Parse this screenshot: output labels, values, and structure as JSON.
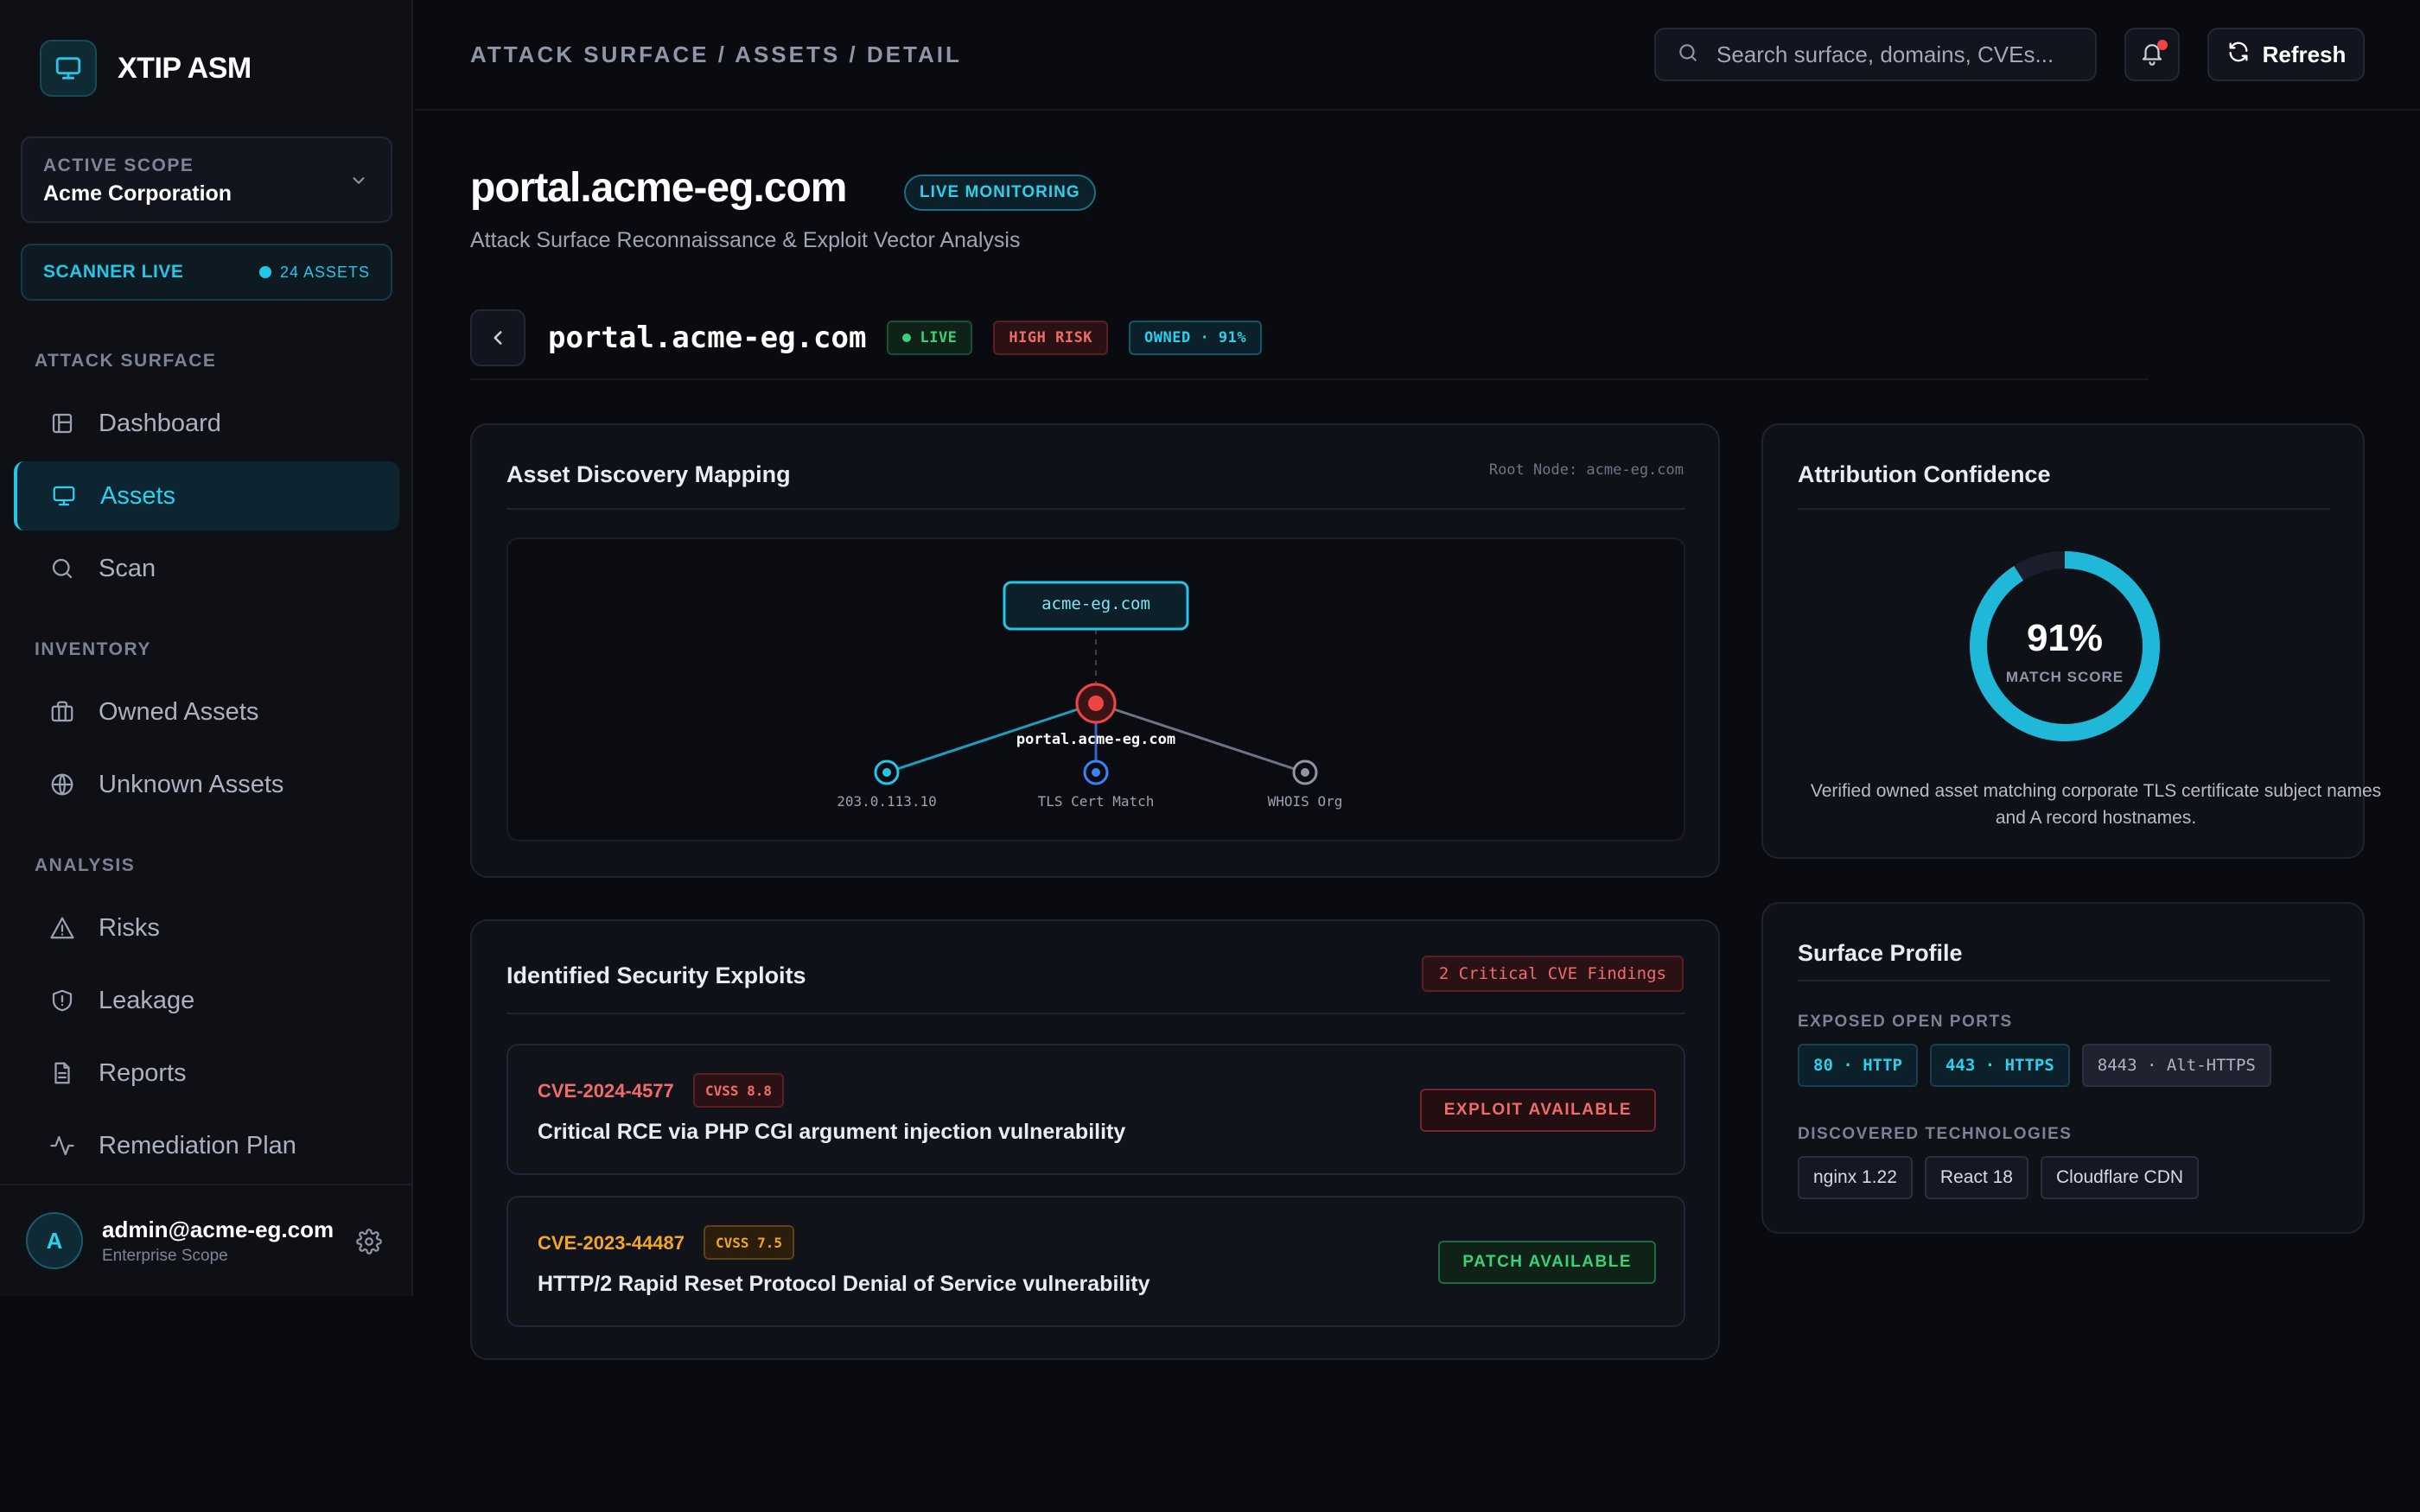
{
  "app": {
    "name": "XTIP ASM"
  },
  "scope": {
    "label": "ACTIVE SCOPE",
    "value": "Acme Corporation"
  },
  "scanner": {
    "label": "SCANNER LIVE",
    "count": "24 ASSETS"
  },
  "nav": {
    "sections": [
      "ATTACK SURFACE",
      "INVENTORY",
      "ANALYSIS"
    ],
    "items": [
      {
        "label": "Dashboard",
        "icon": "layout-icon"
      },
      {
        "label": "Assets",
        "icon": "monitor-icon",
        "active": true
      },
      {
        "label": "Scan",
        "icon": "search-icon"
      },
      {
        "label": "Owned Assets",
        "icon": "briefcase-icon"
      },
      {
        "label": "Unknown Assets",
        "icon": "globe-icon"
      },
      {
        "label": "Risks",
        "icon": "alert-triangle-icon"
      },
      {
        "label": "Leakage",
        "icon": "shield-alert-icon"
      },
      {
        "label": "Reports",
        "icon": "file-text-icon"
      },
      {
        "label": "Remediation Plan",
        "icon": "activity-icon"
      }
    ]
  },
  "user": {
    "email": "admin@acme-eg.com",
    "scope": "Enterprise Scope",
    "initial": "A"
  },
  "topbar": {
    "breadcrumb": "ATTACK SURFACE / ASSETS / DETAIL",
    "search_placeholder": "Search surface, domains, CVEs...",
    "refresh_label": "Refresh"
  },
  "header": {
    "title": "portal.acme-eg.com",
    "badge": "LIVE MONITORING",
    "subtitle": "Attack Surface Reconnaissance & Exploit Vector Analysis"
  },
  "asset": {
    "name": "portal.acme-eg.com",
    "status": "LIVE",
    "risk": "HIGH RISK",
    "owned": "OWNED · 91%"
  },
  "mapping": {
    "title": "Asset Discovery Mapping",
    "root_label": "Root Node: acme-eg.com",
    "root": "acme-eg.com",
    "target": "portal.acme-eg.com",
    "nodes": [
      "203.0.113.10",
      "TLS Cert Match",
      "WHOIS Org"
    ]
  },
  "attribution": {
    "title": "Attribution Confidence",
    "score": 91,
    "score_text": "91%",
    "score_label": "MATCH SCORE",
    "caption": "Verified owned asset matching corporate TLS certificate subject names and A record hostnames."
  },
  "exploits": {
    "title": "Identified Security Exploits",
    "summary": "2 Critical CVE Findings",
    "items": [
      {
        "id": "CVE-2024-4577",
        "cvss": "CVSS 8.8",
        "description": "Critical RCE via PHP CGI argument injection vulnerability",
        "action": "EXPLOIT AVAILABLE"
      },
      {
        "id": "CVE-2023-44487",
        "cvss": "CVSS 7.5",
        "description": "HTTP/2 Rapid Reset Protocol Denial of Service vulnerability",
        "action": "PATCH AVAILABLE"
      }
    ]
  },
  "profile": {
    "title": "Surface Profile",
    "ports_label": "EXPOSED OPEN PORTS",
    "ports": [
      "80 · HTTP",
      "443 · HTTPS",
      "8443 · Alt-HTTPS"
    ],
    "tech_label": "DISCOVERED TECHNOLOGIES",
    "technologies": [
      "nginx 1.22",
      "React 18",
      "Cloudflare CDN"
    ]
  },
  "colors": {
    "accent": "#22c7e8",
    "critical": "#ef4444",
    "warning": "#f5a524",
    "success": "#39d27a"
  }
}
